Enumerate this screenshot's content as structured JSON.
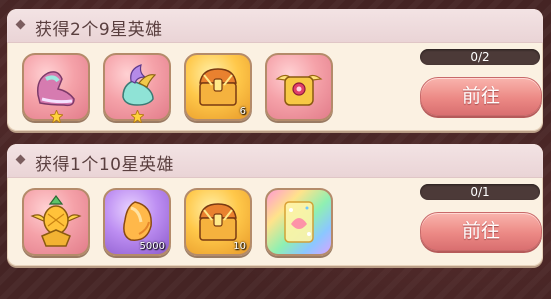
{
  "tasks": [
    {
      "title": "获得2个9星英雄",
      "progress_text": "0/2",
      "progress_fraction": 0,
      "button_label": "前往",
      "rewards": [
        {
          "icon": "pink-boots-icon",
          "quantity": ""
        },
        {
          "icon": "winged-shoes-icon",
          "quantity": ""
        },
        {
          "icon": "treasure-chest-icon",
          "quantity": "6"
        },
        {
          "icon": "golden-winged-chest-icon",
          "quantity": ""
        }
      ]
    },
    {
      "title": "获得1个10星英雄",
      "progress_text": "0/1",
      "progress_fraction": 0,
      "button_label": "前往",
      "rewards": [
        {
          "icon": "golden-pineapple-badge-icon",
          "quantity": ""
        },
        {
          "icon": "mango-fruit-icon",
          "quantity": "5000"
        },
        {
          "icon": "treasure-chest-icon",
          "quantity": "10"
        },
        {
          "icon": "rainbow-card-icon",
          "quantity": ""
        }
      ]
    }
  ]
}
